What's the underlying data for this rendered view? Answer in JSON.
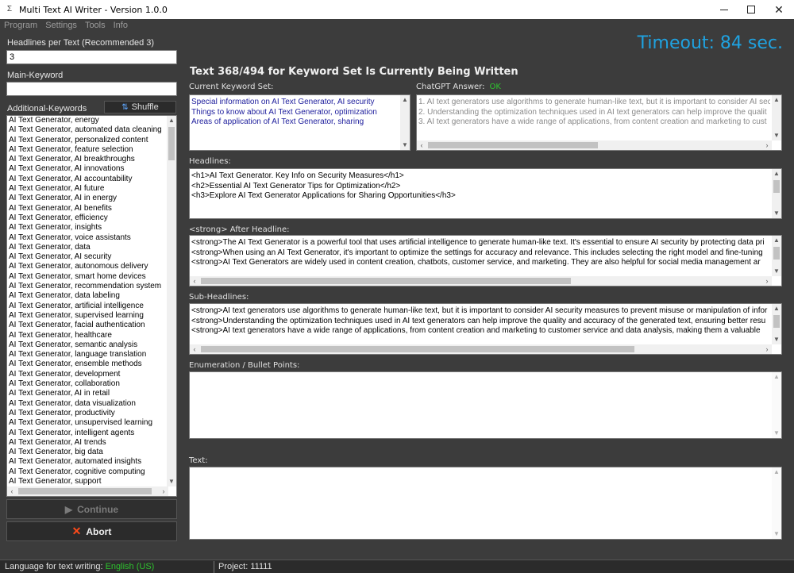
{
  "window": {
    "title": "Multi Text AI Writer - Version 1.0.0",
    "icon_glyph": "Σ"
  },
  "menu": [
    "Program",
    "Settings",
    "Tools",
    "Info"
  ],
  "left": {
    "headlines_label": "Headlines per Text (Recommended 3)",
    "headlines_value": "3",
    "main_keyword_label": "Main-Keyword",
    "main_keyword_value": "",
    "additional_label": "Additional-Keywords",
    "shuffle_label": "Shuffle",
    "keywords": [
      "AI Text Generator, energy",
      "AI Text Generator, automated data cleaning",
      "AI Text Generator, personalized content",
      "AI Text Generator, feature selection",
      "AI Text Generator, AI breakthroughs",
      "AI Text Generator, AI innovations",
      "AI Text Generator, AI accountability",
      "AI Text Generator, AI future",
      "AI Text Generator, AI in energy",
      "AI Text Generator, AI benefits",
      "AI Text Generator, efficiency",
      "AI Text Generator, insights",
      "AI Text Generator, voice assistants",
      "AI Text Generator, data",
      "AI Text Generator, AI security",
      "AI Text Generator, autonomous delivery",
      "AI Text Generator, smart home devices",
      "AI Text Generator, recommendation system",
      "AI Text Generator, data labeling",
      "AI Text Generator, artificial intelligence",
      "AI Text Generator, supervised learning",
      "AI Text Generator, facial authentication",
      "AI Text Generator, healthcare",
      "AI Text Generator, semantic analysis",
      "AI Text Generator, language translation",
      "AI Text Generator, ensemble methods",
      "AI Text Generator, development",
      "AI Text Generator, collaboration",
      "AI Text Generator, AI in retail",
      "AI Text Generator, data visualization",
      "AI Text Generator, productivity",
      "AI Text Generator, unsupervised learning",
      "AI Text Generator, intelligent agents",
      "AI Text Generator, AI trends",
      "AI Text Generator, big data",
      "AI Text Generator, automated insights",
      "AI Text Generator, cognitive computing",
      "AI Text Generator, support"
    ],
    "continue_label": "Continue",
    "abort_label": "Abort"
  },
  "right": {
    "timeout": "Timeout: 84 sec.",
    "heading": "Text 368/494 for Keyword Set Is Currently Being Written",
    "keyword_set_label": "Current Keyword Set:",
    "keyword_set": [
      "Special information on AI Text Generator, AI security",
      "Things to know about AI Text Generator, optimization",
      "Areas of application of AI Text Generator, sharing"
    ],
    "chatgpt_label": "ChatGPT Answer:",
    "chatgpt_status": "OK",
    "chatgpt_answer": [
      "1. AI text generators use algorithms to generate human-like text, but it is important to consider AI sec",
      "2. Understanding the optimization techniques used in AI text generators can help improve the qualit",
      "3. AI text generators have a wide range of applications, from content creation and marketing to cust"
    ],
    "headlines_label": "Headlines:",
    "headlines": [
      "<h1>AI Text Generator. Key Info on Security Measures</h1>",
      "<h2>Essential AI Text Generator Tips for Optimization</h2>",
      "<h3>Explore AI Text Generator Applications for Sharing Opportunities</h3>"
    ],
    "after_headline_label": "<strong> After Headline:",
    "after_headline": [
      "<strong>The AI Text Generator is a powerful tool that uses artificial intelligence to generate human-like text. It's essential to ensure AI security by protecting data pri",
      "<strong>When using an AI Text Generator, it's important to optimize the settings for accuracy and relevance. This includes selecting the right model and fine-tuning",
      "<strong>AI Text Generators are widely used in content creation, chatbots, customer service, and marketing. They are also helpful for social media management ar"
    ],
    "sub_headlines_label": "Sub-Headlines:",
    "sub_headlines": [
      "<strong>AI text generators use algorithms to generate human-like text, but it is important to consider AI security measures to prevent misuse or manipulation of infor",
      "<strong>Understanding the optimization techniques used in AI text generators can help improve the quality and accuracy of the generated text, ensuring better resu",
      "<strong>AI text generators have a wide range of applications, from content creation and marketing to customer service and data analysis, making them a valuable"
    ],
    "enumeration_label": "Enumeration / Bullet Points:",
    "text_label": "Text:"
  },
  "status": {
    "lang_label": "Language for text writing:",
    "lang_value": "English (US)",
    "project": "Project: 11111"
  }
}
